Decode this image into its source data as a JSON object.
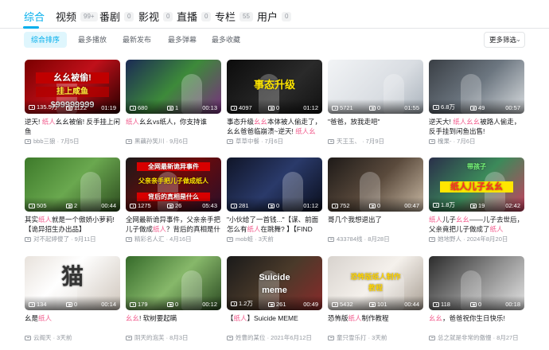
{
  "tabs": [
    {
      "label": "综合",
      "count": ""
    },
    {
      "label": "视频",
      "count": "99+"
    },
    {
      "label": "番剧",
      "count": "0"
    },
    {
      "label": "影视",
      "count": "0"
    },
    {
      "label": "直播",
      "count": "0"
    },
    {
      "label": "专栏",
      "count": "55"
    },
    {
      "label": "用户",
      "count": "0"
    }
  ],
  "sort": [
    "综合排序",
    "最多播放",
    "最新发布",
    "最多弹幕",
    "最多收藏"
  ],
  "more_filter": "更多筛选",
  "colors": {
    "accent": "#00aeec",
    "highlight": "#f25d8e"
  },
  "videos": [
    {
      "title_parts": [
        "逆天! ",
        "纸人",
        "幺幺被偷! 反手挂上闲鱼"
      ],
      "plays": "135.5万",
      "danmaku": "1122",
      "duration": "01:19",
      "uploader": "bbb三狼",
      "date": "7月5日",
      "thumb_text": [
        "幺幺被偷!",
        "挂上咸鱼",
        "$99999999"
      ]
    },
    {
      "title_parts": [
        "",
        "纸人",
        "幺幺vs纸人，你支持谁"
      ],
      "plays": "680",
      "danmaku": "1",
      "duration": "00:13",
      "uploader": "黑藕孙笑川",
      "date": "9月6日",
      "thumb_text": []
    },
    {
      "title_parts": [
        "事态升级",
        "幺幺",
        "本体被人偷走了，幺幺爸爸临崩溃~逆天! ",
        "纸人幺幺",
        ""
      ],
      "plays": "4097",
      "danmaku": "0",
      "duration": "01:12",
      "uploader": "草草中餐",
      "date": "7月6日",
      "thumb_text": [
        "事态升级"
      ]
    },
    {
      "title_parts": [
        "\"爸爸，放我走吧\""
      ],
      "plays": "5721",
      "danmaku": "0",
      "duration": "01:55",
      "uploader": "天王玉、",
      "date": "7月9日",
      "thumb_text": []
    },
    {
      "title_parts": [
        "逆天大! ",
        "纸人幺幺",
        "被路人偷走，反手挂到闲鱼出售!"
      ],
      "plays": "6.8万",
      "danmaku": "49",
      "duration": "00:57",
      "uploader": "槐果-",
      "date": "7月6日",
      "thumb_text": []
    },
    {
      "title_parts": [
        "其实",
        "纸人",
        "就是一个傲娇小萝莉! 【诡异招生办出品】"
      ],
      "plays": "505",
      "danmaku": "2",
      "duration": "00:44",
      "uploader": "对不起婷傻了",
      "date": "9月11日",
      "thumb_text": []
    },
    {
      "title_parts": [
        "全网最新诡异事件，父亲亲手把儿子做成",
        "纸人",
        "？背后的真相是什么？"
      ],
      "plays": "1275",
      "danmaku": "26",
      "duration": "05:43",
      "uploader": "精彩名人汇",
      "date": "4月16日",
      "thumb_text": [
        "全网最新诡异事件",
        "父亲亲手把儿子做成纸人",
        "背后的真相是什么"
      ]
    },
    {
      "title_parts": [
        "\"小伙给了一首钱...\"【谋、前面怎么有",
        "纸人",
        "在跳舞? 】【FIND C..."
      ],
      "plays": "281",
      "danmaku": "0",
      "duration": "01:12",
      "uploader": "mob蛙",
      "date": "3天前",
      "thumb_text": []
    },
    {
      "title_parts": [
        "哥几个我想退出了"
      ],
      "plays": "752",
      "danmaku": "0",
      "duration": "00:47",
      "uploader": "433784线",
      "date": "8月28日",
      "thumb_text": []
    },
    {
      "title_parts": [
        "",
        "纸人",
        "儿子",
        "幺幺",
        "——儿子去世后，父亲竟把儿子做成了",
        "纸人",
        ""
      ],
      "plays": "1.8万",
      "danmaku": "19",
      "duration": "02:42",
      "uploader": "她地野人",
      "date": "2024年8月20日",
      "thumb_text": [
        "带孩子",
        "纸人儿子幺幺"
      ]
    },
    {
      "title_parts": [
        "幺是",
        "纸人",
        ""
      ],
      "plays": "134",
      "danmaku": "0",
      "duration": "00:14",
      "uploader": "云阁天",
      "date": "3天前",
      "thumb_text": [
        "猫"
      ]
    },
    {
      "title_parts": [
        "",
        "幺幺",
        "! 软树要起瞒"
      ],
      "plays": "179",
      "danmaku": "0",
      "duration": "00:12",
      "uploader": "阴天的泡芙",
      "date": "8月3日",
      "thumb_text": []
    },
    {
      "title_parts": [
        "【",
        "纸人",
        "】Suicide MEME"
      ],
      "plays": "1.2万",
      "danmaku": "261",
      "duration": "00:49",
      "uploader": "姓曹的某位",
      "date": "2021年6月12日",
      "thumb_text": [
        "Suicide",
        "meme"
      ]
    },
    {
      "title_parts": [
        "恐怖版",
        "纸人",
        "制作教程"
      ],
      "plays": "5432",
      "danmaku": "101",
      "duration": "00:44",
      "uploader": "童只雪乐打",
      "date": "3天前",
      "thumb_text": [
        "恐怖版纸人制作",
        "教程"
      ]
    },
    {
      "title_parts": [
        "",
        "幺幺",
        "，爸爸祝你生日快乐!"
      ],
      "plays": "118",
      "danmaku": "0",
      "duration": "00:18",
      "uploader": "总之就是非常的傲慢",
      "date": "8月27日",
      "thumb_text": []
    }
  ]
}
